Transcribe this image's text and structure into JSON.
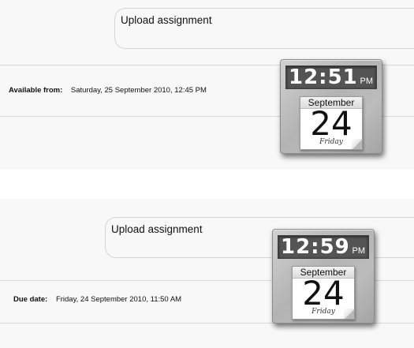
{
  "panels": [
    {
      "assignment_title": "Upload assignment",
      "date_label": "Available from:",
      "date_value": "Saturday, 25 September 2010, 12:45 PM",
      "widget": {
        "time": "12:51",
        "ampm": "PM",
        "month": "September",
        "day": "24",
        "weekday": "Friday"
      }
    },
    {
      "assignment_title": "Upload assignment",
      "date_label": "Due date:",
      "date_value": "Friday, 24 September 2010, 11:50 AM",
      "widget": {
        "time": "12:59",
        "ampm": "PM",
        "month": "September",
        "day": "24",
        "weekday": "Friday"
      }
    }
  ]
}
